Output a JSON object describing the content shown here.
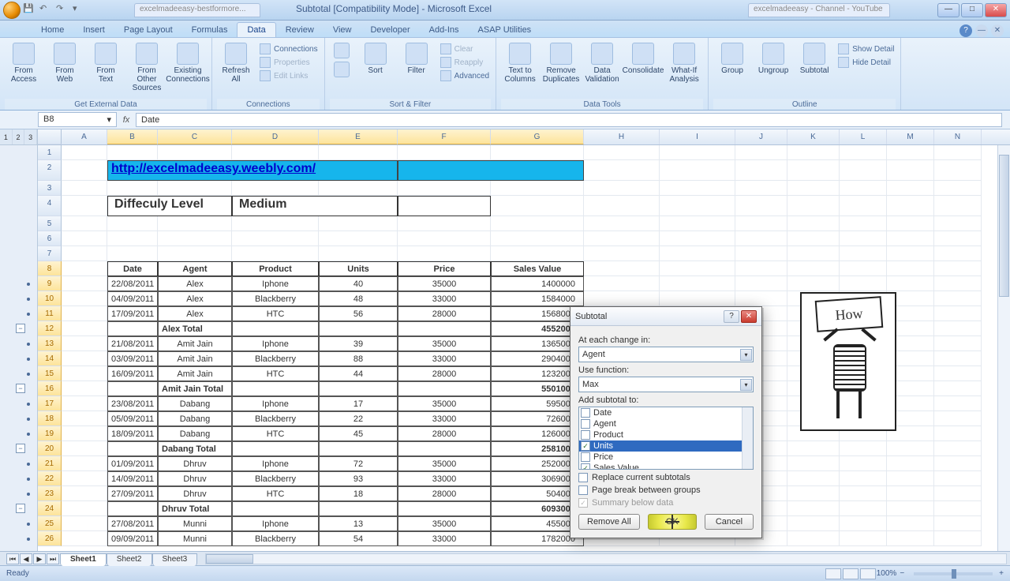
{
  "window": {
    "title": "Subtotal [Compatibility Mode] - Microsoft Excel",
    "browser_tab_left": "excelmadeeasy-bestformore...",
    "browser_tab_right": "excelmadeeasy - Channel - YouTube"
  },
  "ribbon": {
    "tabs": [
      "Home",
      "Insert",
      "Page Layout",
      "Formulas",
      "Data",
      "Review",
      "View",
      "Developer",
      "Add-Ins",
      "ASAP Utilities"
    ],
    "active": "Data",
    "groups": {
      "external": {
        "label": "Get External Data",
        "btns": [
          "From Access",
          "From Web",
          "From Text",
          "From Other Sources",
          "Existing Connections"
        ]
      },
      "connections": {
        "label": "Connections",
        "refresh": "Refresh All",
        "items": [
          "Connections",
          "Properties",
          "Edit Links"
        ]
      },
      "sortfilter": {
        "label": "Sort & Filter",
        "sort": "Sort",
        "filter": "Filter",
        "items": [
          "Clear",
          "Reapply",
          "Advanced"
        ]
      },
      "datatools": {
        "label": "Data Tools",
        "btns": [
          "Text to Columns",
          "Remove Duplicates",
          "Data Validation",
          "Consolidate",
          "What-If Analysis"
        ]
      },
      "outline": {
        "label": "Outline",
        "btns": [
          "Group",
          "Ungroup",
          "Subtotal"
        ],
        "items": [
          "Show Detail",
          "Hide Detail"
        ]
      }
    }
  },
  "formula_bar": {
    "namebox": "B8",
    "formula": "Date"
  },
  "columns": [
    "A",
    "B",
    "C",
    "D",
    "E",
    "F",
    "G",
    "H",
    "I",
    "J",
    "K",
    "L",
    "M",
    "N"
  ],
  "outline_levels": [
    "1",
    "2",
    "3"
  ],
  "banner_url": "http://excelmadeeasy.weebly.com/",
  "difficulty_label": "Diffeculy Level",
  "difficulty_value": "Medium",
  "table": {
    "headers": [
      "Date",
      "Agent",
      "Product",
      "Units",
      "Price",
      "Sales Value"
    ],
    "rows": [
      {
        "n": 9,
        "d": "22/08/2011",
        "a": "Alex",
        "p": "Iphone",
        "u": 40,
        "pr": 35000,
        "sv": 1400000
      },
      {
        "n": 10,
        "d": "04/09/2011",
        "a": "Alex",
        "p": "Blackberry",
        "u": 48,
        "pr": 33000,
        "sv": 1584000
      },
      {
        "n": 11,
        "d": "17/09/2011",
        "a": "Alex",
        "p": "HTC",
        "u": 56,
        "pr": 28000,
        "sv": 1568000
      },
      {
        "n": 12,
        "sub": "Alex Total",
        "sv": 4552000
      },
      {
        "n": 13,
        "d": "21/08/2011",
        "a": "Amit Jain",
        "p": "Iphone",
        "u": 39,
        "pr": 35000,
        "sv": 1365000
      },
      {
        "n": 14,
        "d": "03/09/2011",
        "a": "Amit Jain",
        "p": "Blackberry",
        "u": 88,
        "pr": 33000,
        "sv": 2904000
      },
      {
        "n": 15,
        "d": "16/09/2011",
        "a": "Amit Jain",
        "p": "HTC",
        "u": 44,
        "pr": 28000,
        "sv": 1232000
      },
      {
        "n": 16,
        "sub": "Amit Jain Total",
        "sv": 5501000
      },
      {
        "n": 17,
        "d": "23/08/2011",
        "a": "Dabang",
        "p": "Iphone",
        "u": 17,
        "pr": 35000,
        "sv": 595000
      },
      {
        "n": 18,
        "d": "05/09/2011",
        "a": "Dabang",
        "p": "Blackberry",
        "u": 22,
        "pr": 33000,
        "sv": 726000
      },
      {
        "n": 19,
        "d": "18/09/2011",
        "a": "Dabang",
        "p": "HTC",
        "u": 45,
        "pr": 28000,
        "sv": 1260000
      },
      {
        "n": 20,
        "sub": "Dabang Total",
        "sv": 2581000
      },
      {
        "n": 21,
        "d": "01/09/2011",
        "a": "Dhruv",
        "p": "Iphone",
        "u": 72,
        "pr": 35000,
        "sv": 2520000
      },
      {
        "n": 22,
        "d": "14/09/2011",
        "a": "Dhruv",
        "p": "Blackberry",
        "u": 93,
        "pr": 33000,
        "sv": 3069000
      },
      {
        "n": 23,
        "d": "27/09/2011",
        "a": "Dhruv",
        "p": "HTC",
        "u": 18,
        "pr": 28000,
        "sv": 504000
      },
      {
        "n": 24,
        "sub": "Dhruv Total",
        "sv": 6093000
      },
      {
        "n": 25,
        "d": "27/08/2011",
        "a": "Munni",
        "p": "Iphone",
        "u": 13,
        "pr": 35000,
        "sv": 455000
      },
      {
        "n": 26,
        "d": "09/09/2011",
        "a": "Munni",
        "p": "Blackberry",
        "u": 54,
        "pr": 33000,
        "sv": 1782000
      }
    ]
  },
  "dialog": {
    "title": "Subtotal",
    "at_each_change": "At each change in:",
    "at_each_value": "Agent",
    "use_function": "Use function:",
    "use_function_value": "Max",
    "add_subtotal_to": "Add subtotal to:",
    "fields": [
      {
        "label": "Date",
        "checked": false
      },
      {
        "label": "Agent",
        "checked": false
      },
      {
        "label": "Product",
        "checked": false
      },
      {
        "label": "Units",
        "checked": true,
        "selected": true
      },
      {
        "label": "Price",
        "checked": false
      },
      {
        "label": "Sales Value",
        "checked": true
      }
    ],
    "replace": "Replace current subtotals",
    "pagebreak": "Page break between groups",
    "summary": "Summary below data",
    "remove_all": "Remove All",
    "ok": "OK",
    "cancel": "Cancel"
  },
  "drawing_text": "How",
  "sheets": [
    "Sheet1",
    "Sheet2",
    "Sheet3"
  ],
  "status": {
    "ready": "Ready",
    "zoom": "100%"
  }
}
